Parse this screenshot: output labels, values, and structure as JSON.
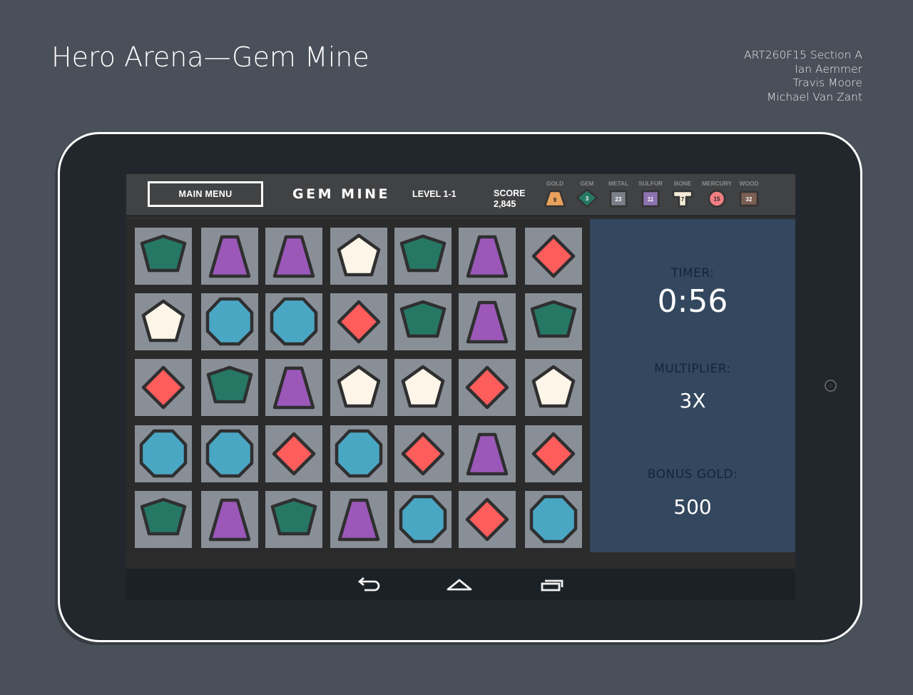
{
  "slide": {
    "title": "Hero Arena—Gem Mine",
    "credits": [
      "ART260F15 Section A",
      "Ian Aemmer",
      "Travis Moore",
      "Michael Van Zant"
    ]
  },
  "topbar": {
    "main_menu_label": "MAIN MENU",
    "game_title": "GEM MINE",
    "level": "LEVEL 1-1",
    "score_label": "SCORE",
    "score_value": "2,845"
  },
  "resources": [
    {
      "name": "GOLD",
      "count": "9",
      "icon": "gold-trapezoid-icon",
      "color": "#e8a25c"
    },
    {
      "name": "GEM",
      "count": "3",
      "icon": "gem-pentagon-icon",
      "color": "#267865"
    },
    {
      "name": "METAL",
      "count": "23",
      "icon": "metal-block-icon",
      "color": "#7b8088"
    },
    {
      "name": "SULFUR",
      "count": "11",
      "icon": "sulfur-block-icon",
      "color": "#8c73b0"
    },
    {
      "name": "BONE",
      "count": "7",
      "icon": "bone-icon",
      "color": "#f4ecd8"
    },
    {
      "name": "MERCURY",
      "count": "15",
      "icon": "mercury-circle-icon",
      "color": "#f07f82"
    },
    {
      "name": "WOOD",
      "count": "32",
      "icon": "wood-plank-icon",
      "color": "#7a5e52"
    }
  ],
  "gem_colors": {
    "pentagon_green": "#267865",
    "trapezoid_purple": "#9b58b8",
    "pentagon_white": "#fdf6e8",
    "diamond_red": "#ff5c5c",
    "octagon_blue": "#4aa7c4"
  },
  "board": [
    [
      "green",
      "purple",
      "purple",
      "white",
      "green",
      "purple",
      "red"
    ],
    [
      "white",
      "blue",
      "blue",
      "red",
      "green",
      "purple",
      "green"
    ],
    [
      "red",
      "green",
      "purple",
      "white",
      "white",
      "red",
      "white"
    ],
    [
      "blue",
      "blue",
      "red",
      "blue",
      "red",
      "purple",
      "red"
    ],
    [
      "green",
      "purple",
      "green",
      "purple",
      "blue",
      "red",
      "blue"
    ]
  ],
  "panel": {
    "timer_label": "TIMER:",
    "timer_value": "0:56",
    "multiplier_label": "MULTIPLIER:",
    "multiplier_value": "3X",
    "bonus_label": "BONUS GOLD:",
    "bonus_value": "500"
  },
  "navbar": {
    "buttons": [
      "back-icon",
      "home-icon",
      "recents-icon"
    ]
  }
}
